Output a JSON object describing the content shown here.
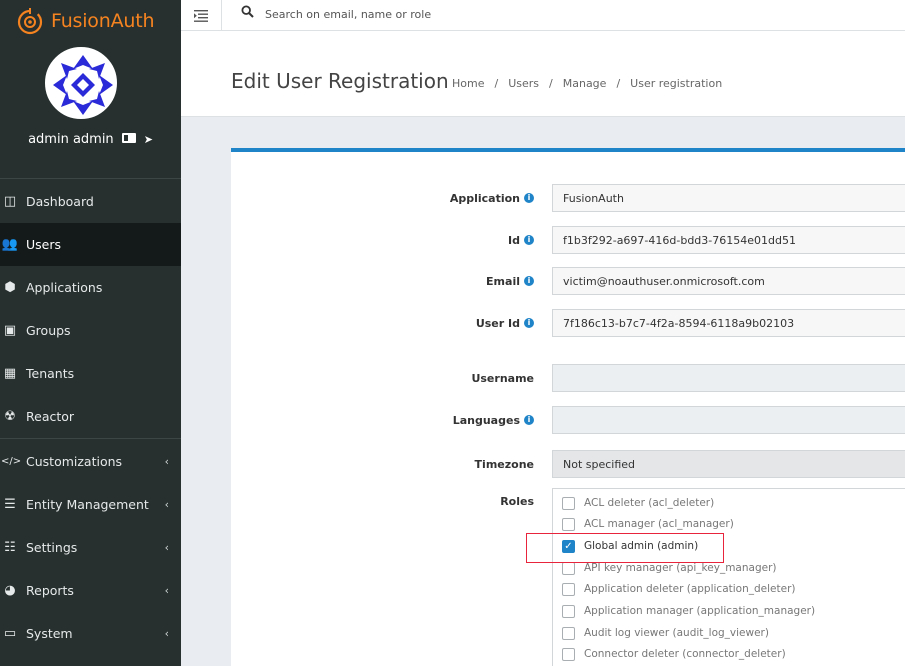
{
  "brand": {
    "name": "FusionAuth",
    "accent": "#f58320"
  },
  "user": {
    "name": "admin admin"
  },
  "nav": [
    {
      "label": "Dashboard",
      "icon": "dashboard-icon",
      "glyph": "◫",
      "chevron": ""
    },
    {
      "label": "Users",
      "icon": "users-icon",
      "glyph": "👥",
      "chevron": "",
      "active": true
    },
    {
      "label": "Applications",
      "icon": "cube-icon",
      "glyph": "⬢",
      "chevron": ""
    },
    {
      "label": "Groups",
      "icon": "groups-icon",
      "glyph": "▣",
      "chevron": ""
    },
    {
      "label": "Tenants",
      "icon": "building-icon",
      "glyph": "▦",
      "chevron": ""
    },
    {
      "label": "Reactor",
      "icon": "radiation-icon",
      "glyph": "☢",
      "chevron": ""
    },
    {
      "label": "Customizations",
      "icon": "code-icon",
      "glyph": "</>",
      "chevron": "‹"
    },
    {
      "label": "Entity Management",
      "icon": "list-icon",
      "glyph": "☰",
      "chevron": "‹"
    },
    {
      "label": "Settings",
      "icon": "sliders-icon",
      "glyph": "☷",
      "chevron": "‹"
    },
    {
      "label": "Reports",
      "icon": "pie-chart-icon",
      "glyph": "◕",
      "chevron": "‹"
    },
    {
      "label": "System",
      "icon": "monitor-icon",
      "glyph": "▭",
      "chevron": "‹"
    }
  ],
  "search": {
    "placeholder": "Search on email, name or role"
  },
  "page": {
    "title": "Edit User Registration",
    "breadcrumb": [
      "Home",
      "Users",
      "Manage",
      "User registration"
    ],
    "breadcrumb_sep": "/"
  },
  "form": {
    "application": {
      "label": "Application",
      "value": "FusionAuth"
    },
    "id": {
      "label": "Id",
      "value": "f1b3f292-a697-416d-bdd3-76154e01dd51"
    },
    "email": {
      "label": "Email",
      "value": "victim@noauthuser.onmicrosoft.com"
    },
    "user_id": {
      "label": "User Id",
      "value": "7f186c13-b7c7-4f2a-8594-6118a9b02103"
    },
    "username": {
      "label": "Username",
      "value": ""
    },
    "languages": {
      "label": "Languages",
      "value": ""
    },
    "timezone": {
      "label": "Timezone",
      "value": "Not specified"
    },
    "roles_label": "Roles",
    "roles": [
      {
        "label": "ACL deleter (acl_deleter)",
        "checked": false
      },
      {
        "label": "ACL manager (acl_manager)",
        "checked": false
      },
      {
        "label": "Global admin (admin)",
        "checked": true
      },
      {
        "label": "API key manager (api_key_manager)",
        "checked": false
      },
      {
        "label": "Application deleter (application_deleter)",
        "checked": false
      },
      {
        "label": "Application manager (application_manager)",
        "checked": false
      },
      {
        "label": "Audit log viewer (audit_log_viewer)",
        "checked": false
      },
      {
        "label": "Connector deleter (connector_deleter)",
        "checked": false
      }
    ]
  },
  "colors": {
    "primary": "#1f84c8",
    "highlight": "#e8243c",
    "sidebar": "#27302f"
  }
}
